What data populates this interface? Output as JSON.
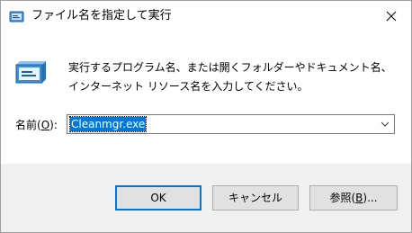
{
  "window": {
    "title": "ファイル名を指定して実行",
    "close_icon": "close-icon"
  },
  "content": {
    "description": "実行するプログラム名、または開くフォルダーやドキュメント名、インターネット リソース名を入力してください。",
    "name_label_prefix": "名前(",
    "name_label_mnemonic": "O",
    "name_label_suffix": "):",
    "input_value": "Cleanmgr.exe"
  },
  "buttons": {
    "ok": "OK",
    "cancel": "キャンセル",
    "browse_prefix": "参照(",
    "browse_mnemonic": "B",
    "browse_suffix": ")..."
  },
  "colors": {
    "accent": "#0078d7",
    "footer_bg": "#f0f0f0",
    "button_bg": "#e1e1e1"
  }
}
